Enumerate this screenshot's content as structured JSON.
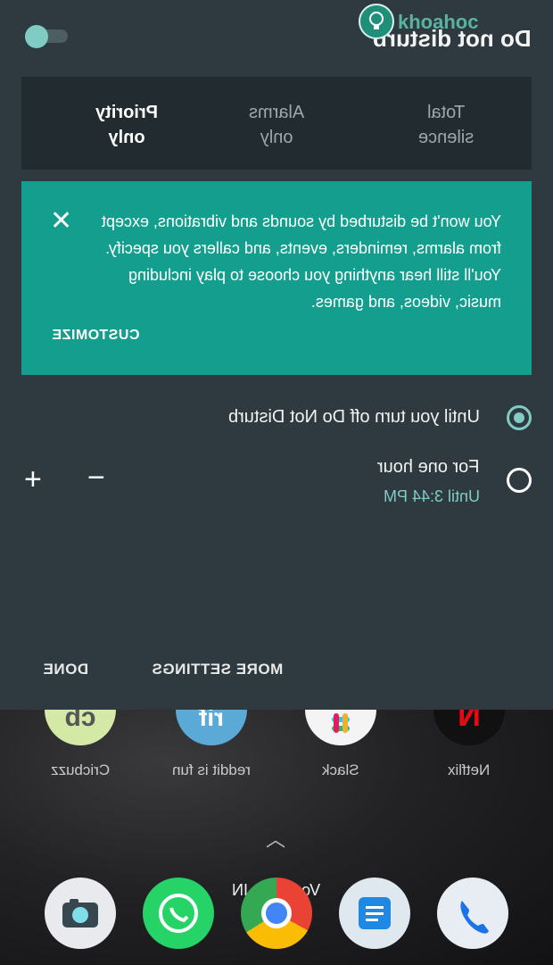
{
  "header": {
    "title": "Do not disturb"
  },
  "watermark": {
    "text": "khoahoc"
  },
  "modes": [
    {
      "label": "Priority\nonly",
      "active": true
    },
    {
      "label": "Alarms\nonly",
      "active": false
    },
    {
      "label": "Total\nsilence",
      "active": false
    }
  ],
  "info_card": {
    "message": "You won't be disturbed by sounds and vibrations, except from alarms, reminders, events, and callers you specify. You'll still hear anything you choose to play including music, videos, and games.",
    "customize_label": "CUSTOMIZE"
  },
  "durations": {
    "option1": {
      "label": "Until you turn off Do Not Disturb",
      "selected": true
    },
    "option2": {
      "label": "For one hour",
      "sublabel": "Until 3:44 PM",
      "selected": false
    },
    "increase_symbol": "+",
    "decrease_symbol": "−"
  },
  "footer": {
    "more_settings": "MORE SETTINGS",
    "done": "DONE"
  },
  "home": {
    "apps": [
      {
        "label": "Netflix",
        "icon": "netflix-icon"
      },
      {
        "label": "Slack",
        "icon": "slack-icon"
      },
      {
        "label": "reddit is fun",
        "icon": "reddit-is-fun-icon"
      },
      {
        "label": "Cricbuzz",
        "icon": "cricbuzz-icon"
      }
    ],
    "carrier": "Vodafone IN",
    "dock": [
      "phone-icon",
      "messages-icon",
      "chrome-icon",
      "whatsapp-icon",
      "camera-icon"
    ]
  },
  "colors": {
    "accent": "#80cbc4",
    "card": "#139e8e",
    "panel": "#2e3a40"
  }
}
